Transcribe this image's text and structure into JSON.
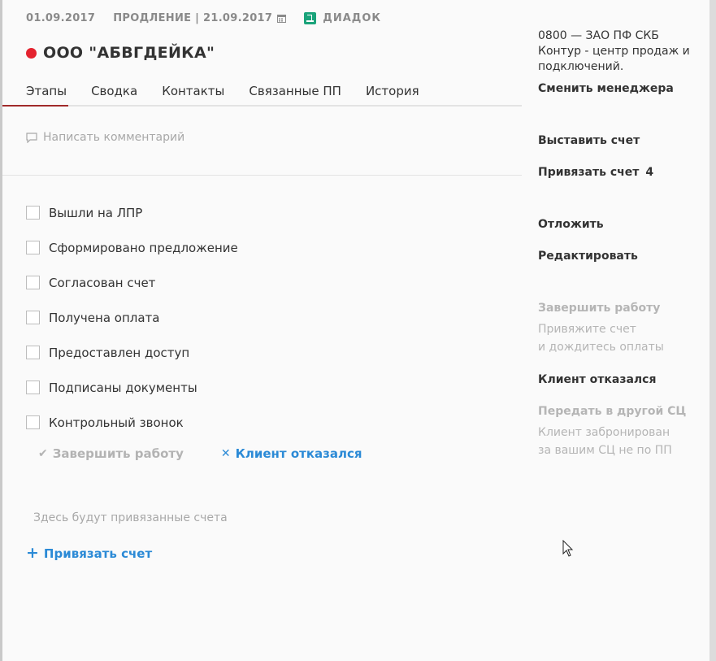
{
  "header": {
    "date": "01.09.2017",
    "renewal": "ПРОДЛЕНИЕ | 21.09.2017",
    "diadoc": "ДИАДОК",
    "company_name": "ООО \"АБВГДЕЙКА\"",
    "status_color": "#e4232f"
  },
  "tabs": [
    {
      "label": "Этапы",
      "active": true
    },
    {
      "label": "Сводка"
    },
    {
      "label": "Контакты"
    },
    {
      "label": "Связанные ПП"
    },
    {
      "label": "История"
    }
  ],
  "comment_placeholder": "Написать комментарий",
  "stages": [
    {
      "label": "Вышли на ЛПР",
      "checked": false
    },
    {
      "label": "Сформировано предложение",
      "checked": false
    },
    {
      "label": "Согласован счет",
      "checked": false
    },
    {
      "label": "Получена оплата",
      "checked": false
    },
    {
      "label": "Предоставлен доступ",
      "checked": false
    },
    {
      "label": "Подписаны документы",
      "checked": false
    },
    {
      "label": "Контрольный звонок",
      "checked": false
    }
  ],
  "actions": {
    "finish_label": "Завершить работу",
    "reject_label": "Клиент отказался"
  },
  "invoices": {
    "placeholder": "Здесь будут привязанные счета",
    "bind_label": "Привязать счет"
  },
  "sidebar": {
    "manager_line1": "0800 — ЗАО ПФ СКБ",
    "manager_line2": "Контур - центр продаж и",
    "manager_line3": "подключений.",
    "change_manager": "Сменить менеджера",
    "issue_invoice": "Выставить счет",
    "bind_invoice": "Привязать счет",
    "bind_invoice_count": "4",
    "postpone": "Отложить",
    "edit": "Редактировать",
    "finish_work": "Завершить работу",
    "finish_note_1": "Привяжите счет",
    "finish_note_2": "и дождитесь оплаты",
    "client_refused": "Клиент отказался",
    "transfer": "Передать в другой СЦ",
    "transfer_note_1": "Клиент забронирован",
    "transfer_note_2": "за вашим СЦ не по ПП"
  },
  "colors": {
    "accent_link": "#2b8ad6",
    "active_tab_underline": "#a12a2a",
    "diadoc_green": "#1aa37a"
  }
}
